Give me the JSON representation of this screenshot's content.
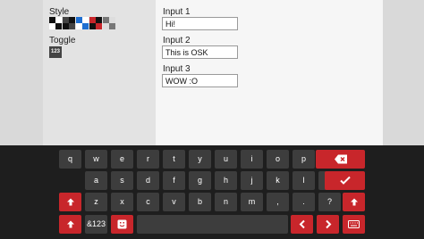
{
  "settings": {
    "style_label": "Style",
    "toggle_label": "Toggle",
    "toggle_button": "123",
    "style_swatches": [
      {
        "name": "dark-on-light",
        "bg": "#ffffff",
        "fg": "#111111"
      },
      {
        "name": "dark",
        "bg": "#111111",
        "fg": "#444444"
      },
      {
        "name": "blue-accent",
        "bg": "#ffffff",
        "fg": "#1f6fd1"
      },
      {
        "name": "dark-red",
        "bg": "#111111",
        "fg": "#c8262b"
      },
      {
        "name": "grey",
        "bg": "#dddddd",
        "fg": "#777777"
      }
    ]
  },
  "inputs": [
    {
      "label": "Input 1",
      "value": "Hi!"
    },
    {
      "label": "Input 2",
      "value": "This is OSK"
    },
    {
      "label": "Input 3",
      "value": "WOW :O"
    }
  ],
  "keyboard": {
    "row1": [
      "q",
      "w",
      "e",
      "r",
      "t",
      "y",
      "u",
      "i",
      "o",
      "p"
    ],
    "row2": [
      "a",
      "s",
      "d",
      "f",
      "g",
      "h",
      "j",
      "k",
      "l",
      "'"
    ],
    "row3": [
      "z",
      "x",
      "c",
      "v",
      "b",
      "n",
      "m",
      ",",
      ".",
      "?"
    ],
    "backspace_icon": "backspace-icon",
    "enter_icon": "checkmark-icon",
    "shift_icon": "shift-arrow-icon",
    "symbols_label": "&123",
    "emoji_icon": "emoji-icon",
    "space_label": "",
    "left_icon": "arrow-left-icon",
    "right_icon": "arrow-right-icon",
    "hide_icon": "keyboard-icon"
  },
  "colors": {
    "accent": "#c8262b",
    "key": "#3d3d3d",
    "keyboard_bg": "#1e1e1e"
  }
}
